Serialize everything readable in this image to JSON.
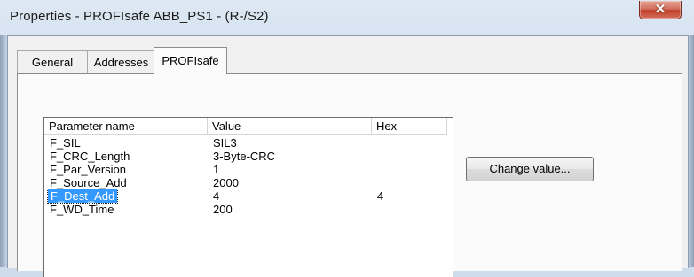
{
  "window": {
    "title": "Properties - PROFIsafe ABB_PS1 - (R-/S2)",
    "close_glyph": "✕"
  },
  "tabs": [
    {
      "label": "General",
      "active": false
    },
    {
      "label": "Addresses",
      "active": false
    },
    {
      "label": "PROFIsafe",
      "active": true
    }
  ],
  "table": {
    "columns": [
      "Parameter name",
      "Value",
      "Hex"
    ],
    "rows": [
      {
        "name": "F_SIL",
        "value": "SIL3",
        "hex": ""
      },
      {
        "name": "F_CRC_Length",
        "value": "3-Byte-CRC",
        "hex": ""
      },
      {
        "name": "F_Par_Version",
        "value": "1",
        "hex": ""
      },
      {
        "name": "F_Source_Add",
        "value": "2000",
        "hex": ""
      },
      {
        "name": "F_Dest_Add",
        "value": "4",
        "hex": "4",
        "selected": true
      },
      {
        "name": "F_WD_Time",
        "value": "200",
        "hex": ""
      }
    ]
  },
  "buttons": {
    "change_value": "Change value..."
  },
  "colors": {
    "selection": "#3399ff",
    "close_button": "#c1402b"
  }
}
